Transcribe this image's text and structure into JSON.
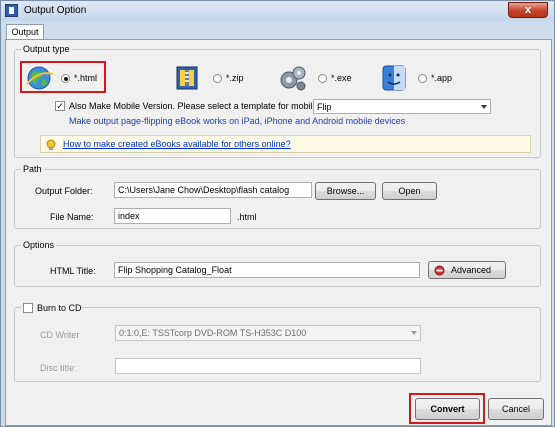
{
  "window": {
    "title": "Output Option",
    "close_glyph": "x",
    "tab": "Output"
  },
  "output_type": {
    "label": "Output type",
    "options": [
      {
        "label": "*.html",
        "selected": true,
        "icon": "globe-icon"
      },
      {
        "label": "*.zip",
        "selected": false,
        "icon": "zip-archive-icon"
      },
      {
        "label": "*.exe",
        "selected": false,
        "icon": "gears-icon"
      },
      {
        "label": "*.app",
        "selected": false,
        "icon": "mac-finder-icon"
      }
    ],
    "mobile_checkbox_label": "Also Make Mobile Version. Please select a template for mobile:",
    "mobile_checked": true,
    "mobile_template": "Flip",
    "mobile_note": "Make output page-flipping eBook works on iPad, iPhone and Android mobile devices",
    "help_link": "How to make created eBooks available for others online?"
  },
  "path": {
    "label": "Path",
    "output_folder_label": "Output Folder:",
    "output_folder_value": "C:\\Users\\Jane Chow\\Desktop\\flash catalog",
    "browse_label": "Browse...",
    "open_label": "Open",
    "file_name_label": "File Name:",
    "file_name_value": "index",
    "file_ext": ".html"
  },
  "options": {
    "label": "Options",
    "html_title_label": "HTML Title:",
    "html_title_value": "Flip Shopping Catalog_Float",
    "advanced_label": "Advanced"
  },
  "burn": {
    "label": "Burn to CD",
    "checked": false,
    "cd_writer_label": "CD Writer",
    "cd_writer_value": "0:1:0,E: TSSTcorp DVD-ROM TS-H353C D100",
    "disc_title_label": "Disc title:",
    "disc_title_value": ""
  },
  "footer": {
    "convert_label": "Convert",
    "cancel_label": "Cancel"
  },
  "colors": {
    "highlight_box": "#d21a1a",
    "link": "#0033cc",
    "note": "#1f3ea8"
  }
}
